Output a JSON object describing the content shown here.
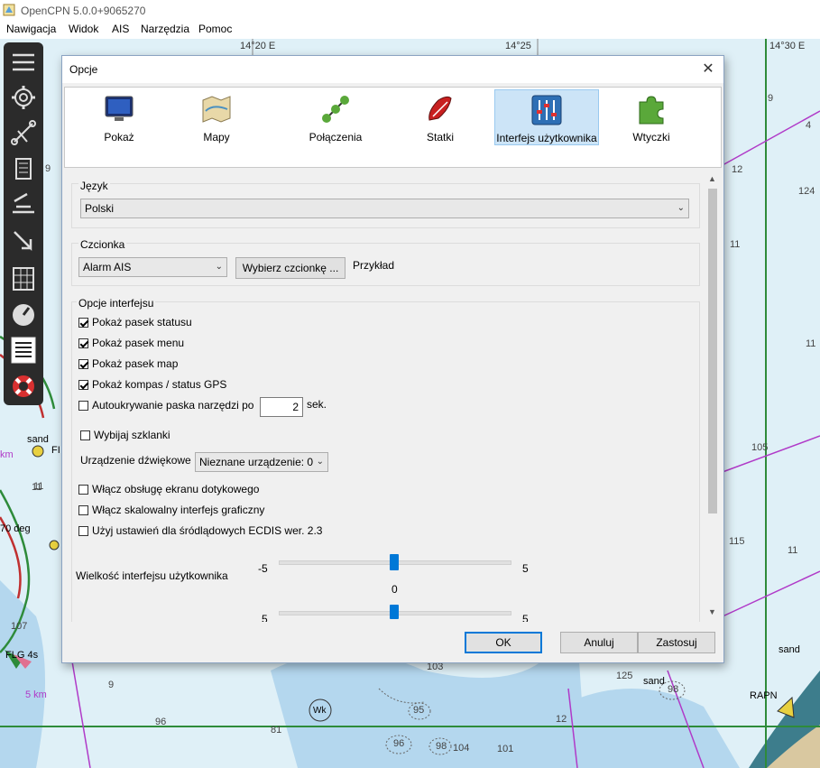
{
  "window": {
    "title": "OpenCPN 5.0.0+9065270"
  },
  "menubar": {
    "items": [
      "Nawigacja",
      "Widok",
      "AIS",
      "Narzędzia",
      "Pomoc"
    ]
  },
  "chart": {
    "lon_labels": [
      "14°20 E",
      "14°25",
      "14°30 E"
    ],
    "depths": [
      "9",
      "12",
      "4",
      "124",
      "11",
      "105",
      "11",
      "11",
      "11",
      "115",
      "103",
      "125",
      "98",
      "95",
      "96",
      "104",
      "101",
      "9",
      "11",
      "107",
      "12",
      "81",
      "98",
      "96",
      "9"
    ],
    "labels": [
      "sand",
      "FI",
      "sand",
      "sand",
      "RAPN",
      "Wk",
      "FLG 4s",
      "70 deg",
      "5 km",
      "km"
    ],
    "colors": {
      "water": "#dff0f7",
      "deep": "#b4d7ee",
      "land": "#d9c8a0",
      "grid_green": "#2e8b3a",
      "route_purple": "#b03ac8"
    }
  },
  "toolbar": {
    "icons": [
      "menu-icon",
      "gear-icon",
      "route-icon",
      "document-icon",
      "waypoint-icon",
      "arrow-icon",
      "grid-icon",
      "dial-icon",
      "list-icon",
      "lifebuoy-icon"
    ]
  },
  "dialog": {
    "title": "Opcje",
    "close": "✕",
    "tabs": [
      {
        "label": "Pokaż",
        "icon": "monitor-icon"
      },
      {
        "label": "Mapy",
        "icon": "map-icon"
      },
      {
        "label": "Połączenia",
        "icon": "connections-icon"
      },
      {
        "label": "Statki",
        "icon": "ship-icon"
      },
      {
        "label": "Interfejs użytkownika",
        "icon": "sliders-icon"
      },
      {
        "label": "Wtyczki",
        "icon": "puzzle-icon"
      }
    ],
    "selected_tab": "Interfejs użytkownika",
    "language": {
      "group": "Język",
      "value": "Polski"
    },
    "font": {
      "group": "Czcionka",
      "combo": "Alarm AIS",
      "choose_button": "Wybierz czcionkę ...",
      "sample": "Przykład"
    },
    "interface": {
      "group": "Opcje interfejsu",
      "checks": [
        {
          "label": "Pokaż pasek statusu",
          "checked": true
        },
        {
          "label": "Pokaż pasek menu",
          "checked": true
        },
        {
          "label": "Pokaż pasek map",
          "checked": true
        },
        {
          "label": "Pokaż kompas / status GPS",
          "checked": true
        }
      ],
      "autohide": {
        "label": "Autoukrywanie paska narzędzi po",
        "value": "2",
        "unit": "sek.",
        "checked": false
      },
      "bells": {
        "label": "Wybijaj szklanki",
        "checked": false
      },
      "sound_device": {
        "label": "Urządzenie dźwiękowe",
        "value": "Nieznane urządzenie: 0"
      },
      "checks2": [
        {
          "label": "Włącz obsługę ekranu dotykowego",
          "checked": false
        },
        {
          "label": "Włącz skalowalny interfejs graficzny",
          "checked": false
        },
        {
          "label": "Użyj ustawień dla śródlądowych ECDIS wer. 2.3",
          "checked": false
        }
      ],
      "ui_size": {
        "label": "Wielkość interfejsu użytkownika",
        "min": "-5",
        "max": "5",
        "value": "0",
        "level": 0
      },
      "slider2": {
        "min": "5",
        "max": "5"
      }
    },
    "buttons": {
      "ok": "OK",
      "cancel": "Anuluj",
      "apply": "Zastosuj"
    }
  }
}
